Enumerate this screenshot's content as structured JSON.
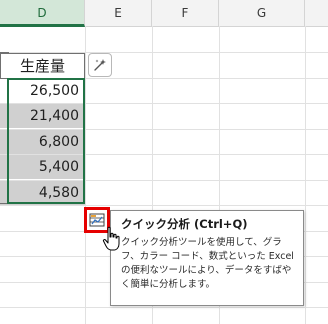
{
  "columns": [
    {
      "label": "D",
      "selected": true
    },
    {
      "label": "E",
      "selected": false
    },
    {
      "label": "F",
      "selected": false
    },
    {
      "label": "G",
      "selected": false
    }
  ],
  "header_cell": "生産量",
  "values": [
    "26,500",
    "21,400",
    "6,800",
    "5,400",
    "4,580"
  ],
  "tooltip": {
    "title": "クイック分析 (Ctrl+Q)",
    "body": "クイック分析ツールを使用して、グラフ、カラー コード、数式といった Excel の便利なツールにより、データをすばやく簡単に分析します。"
  },
  "colors": {
    "accent": "#217346",
    "highlight": "#e60000",
    "selection_fill": "#d0d0d0"
  },
  "icons": {
    "ideas": "sparkle-icon",
    "quick_analysis": "quick-analysis-icon"
  }
}
